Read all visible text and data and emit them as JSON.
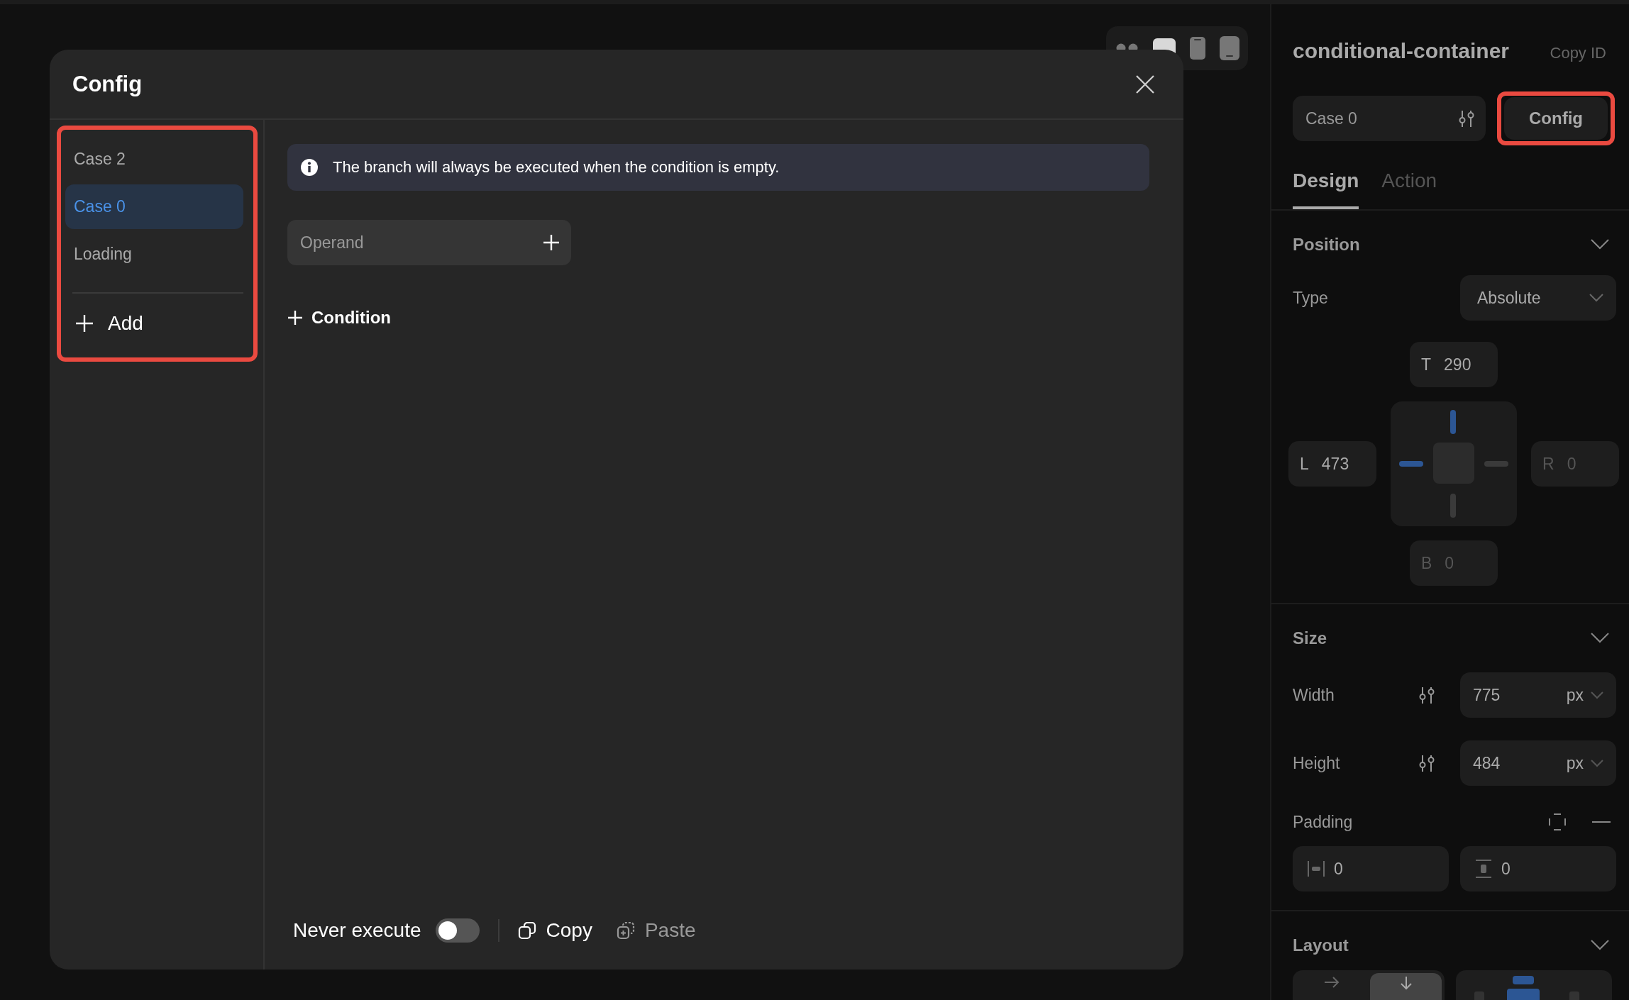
{
  "device_toolbar": {
    "devices": [
      {
        "kind": "dots",
        "selected": false
      },
      {
        "kind": "desktop",
        "selected": true
      },
      {
        "kind": "phone",
        "selected": false
      },
      {
        "kind": "tablet",
        "selected": false
      }
    ]
  },
  "config_dialog": {
    "title": "Config",
    "cases_highlighted": true,
    "cases": [
      {
        "label": "Case 2",
        "selected": false
      },
      {
        "label": "Case 0",
        "selected": true
      },
      {
        "label": "Loading",
        "selected": false
      }
    ],
    "add_label": "Add",
    "info": "The branch will always be executed when the condition is empty.",
    "operand_placeholder": "Operand",
    "add_condition": "Condition",
    "never_execute": {
      "label": "Never execute",
      "on": false
    },
    "copy": {
      "label": "Copy",
      "disabled": false
    },
    "paste": {
      "label": "Paste",
      "disabled": true
    }
  },
  "inspector": {
    "component_name": "conditional-container",
    "copy_id": "Copy ID",
    "case_select": "Case 0",
    "config_button": {
      "label": "Config",
      "highlighted": true
    },
    "tabs": [
      {
        "label": "Design",
        "selected": true
      },
      {
        "label": "Action",
        "selected": false
      }
    ],
    "position": {
      "title": "Position",
      "type_label": "Type",
      "type_value": "Absolute",
      "offsets": [
        {
          "kind": "top",
          "letter": "T",
          "value": "290",
          "active": true
        },
        {
          "kind": "left",
          "letter": "L",
          "value": "473",
          "active": true
        },
        {
          "kind": "right",
          "letter": "R",
          "value": "0",
          "active": false
        },
        {
          "kind": "bottom",
          "letter": "B",
          "value": "0",
          "active": false
        }
      ]
    },
    "size": {
      "title": "Size",
      "fields": [
        {
          "label": "Width",
          "value": "775",
          "unit": "px"
        },
        {
          "label": "Height",
          "value": "484",
          "unit": "px"
        }
      ],
      "padding_label": "Padding",
      "padding": [
        {
          "kind": "horizontal",
          "value": "0"
        },
        {
          "kind": "vertical",
          "value": "0"
        }
      ]
    },
    "layout": {
      "title": "Layout",
      "direction": [
        {
          "kind": "row",
          "selected": false
        },
        {
          "kind": "column",
          "selected": true
        }
      ]
    }
  }
}
